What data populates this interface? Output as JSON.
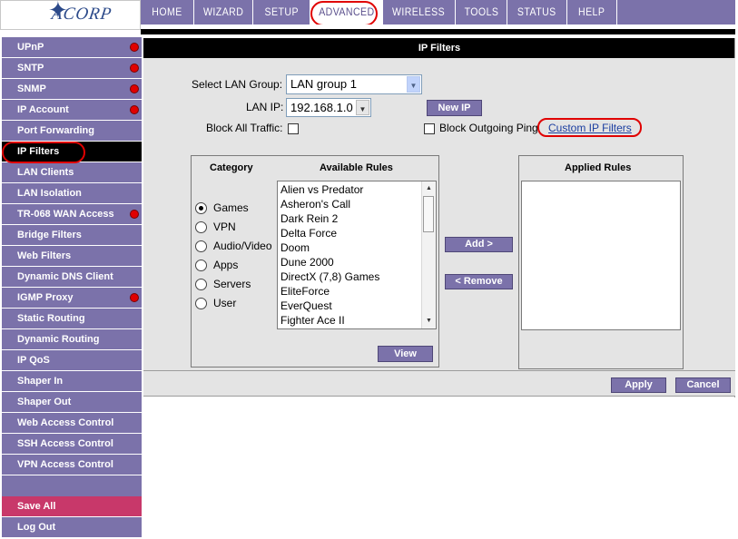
{
  "brand": {
    "logo_text": "ACORP"
  },
  "topnav": {
    "tabs": [
      {
        "label": "HOME"
      },
      {
        "label": "WIZARD"
      },
      {
        "label": "SETUP"
      },
      {
        "label": "ADVANCED",
        "active": true
      },
      {
        "label": "WIRELESS"
      },
      {
        "label": "TOOLS"
      },
      {
        "label": "STATUS"
      },
      {
        "label": "HELP"
      }
    ]
  },
  "sidebar": {
    "items": [
      {
        "label": "UPnP",
        "dot": true
      },
      {
        "label": "SNTP",
        "dot": true
      },
      {
        "label": "SNMP",
        "dot": true
      },
      {
        "label": "IP Account",
        "dot": true
      },
      {
        "label": "Port Forwarding"
      },
      {
        "label": "IP Filters",
        "active": true
      },
      {
        "label": "LAN Clients"
      },
      {
        "label": "LAN Isolation"
      },
      {
        "label": "TR-068 WAN Access",
        "dot": true
      },
      {
        "label": "Bridge Filters"
      },
      {
        "label": "Web Filters"
      },
      {
        "label": "Dynamic DNS Client"
      },
      {
        "label": "IGMP Proxy",
        "dot": true
      },
      {
        "label": "Static Routing"
      },
      {
        "label": "Dynamic Routing"
      },
      {
        "label": "IP QoS"
      },
      {
        "label": "Shaper In"
      },
      {
        "label": "Shaper Out"
      },
      {
        "label": "Web Access Control"
      },
      {
        "label": "SSH Access Control"
      },
      {
        "label": "VPN Access Control"
      }
    ],
    "save_label": "Save All",
    "logout_label": "Log Out"
  },
  "panel": {
    "title": "IP Filters",
    "lan_group_label": "Select LAN Group:",
    "lan_group_value": "LAN group 1",
    "lan_ip_label": "LAN IP:",
    "lan_ip_value": "192.168.1.0",
    "new_ip_button": "New IP",
    "block_all_label": "Block All Traffic:",
    "block_ping_label": "Block Outgoing Ping",
    "custom_filters_link": "Custom IP Filters",
    "category_header": "Category",
    "available_header": "Available Rules",
    "applied_header": "Applied Rules",
    "categories": [
      {
        "label": "Games",
        "checked": true
      },
      {
        "label": "VPN"
      },
      {
        "label": "Audio/Video"
      },
      {
        "label": "Apps"
      },
      {
        "label": "Servers"
      },
      {
        "label": "User"
      }
    ],
    "available_rules": [
      "Alien vs Predator",
      "Asheron's Call",
      "Dark Rein 2",
      "Delta Force",
      "Doom",
      "Dune 2000",
      "DirectX (7,8) Games",
      "EliteForce",
      "EverQuest",
      "Fighter Ace II"
    ],
    "add_button": "Add >",
    "remove_button": "< Remove",
    "view_button": "View",
    "apply_button": "Apply",
    "cancel_button": "Cancel"
  },
  "colors": {
    "nav_purple": "#7b72aa",
    "save_pink": "#c8386a",
    "annotation_red": "#e00000"
  }
}
